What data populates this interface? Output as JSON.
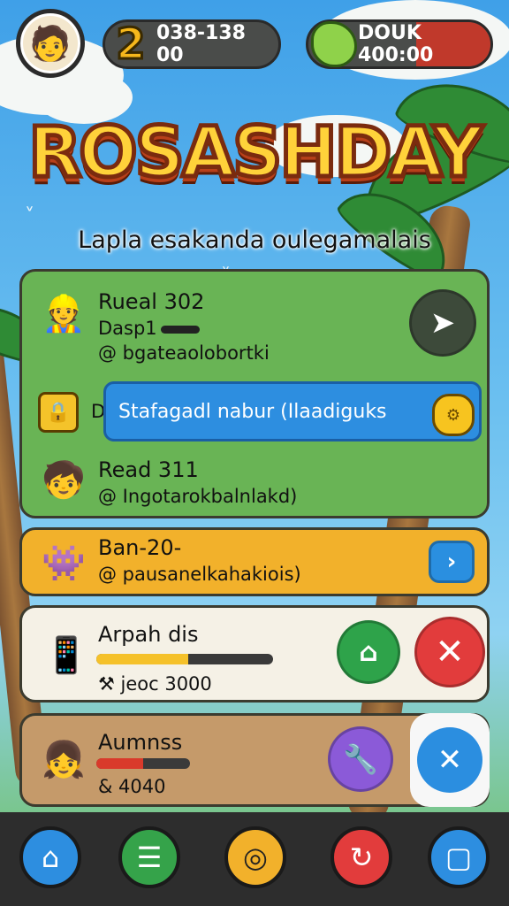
{
  "header": {
    "coins": "038-138 00",
    "gems": "DOUK 400:00",
    "colors": {
      "coin": "#f6b81c",
      "gem": "#8fd24a",
      "gem_tail": "#c0392b"
    }
  },
  "title": "ROSASHDAY",
  "subtitle": "Lapla esakanda oulegamalais",
  "cards": {
    "green": {
      "row1": {
        "title": "Rueal 302",
        "line2": "Dasp1",
        "line3": "@ bgateaolobortki"
      },
      "banner": {
        "partial": "D",
        "text": "Stafagadl nabur (Ilaadiguks"
      },
      "row3": {
        "title": "Read 311",
        "line2": "@ Ingotarokbalnlakd)"
      }
    },
    "yellow": {
      "title": "Ban-20-",
      "line2": "@ pausanelkahakiois)"
    },
    "white": {
      "title": "Arpah dis",
      "line2": "jeoc 3000",
      "progress": 0.52
    },
    "brown": {
      "title": "Aumnss",
      "line2": "& 4040",
      "progress": 0.5
    }
  },
  "icons": {
    "avatar": "player-avatar-icon",
    "coin": "coin-icon",
    "gem": "gem-icon",
    "arrow": "arrow-right-icon",
    "lock": "lock-icon",
    "gear": "gear-icon",
    "home": "home-icon",
    "news": "news-icon",
    "camera": "camera-icon",
    "refresh": "refresh-icon",
    "chat": "chat-icon",
    "close": "close-icon",
    "upgrade": "upgrade-icon",
    "wrench": "wrench-icon",
    "tools": "tools-icon"
  }
}
